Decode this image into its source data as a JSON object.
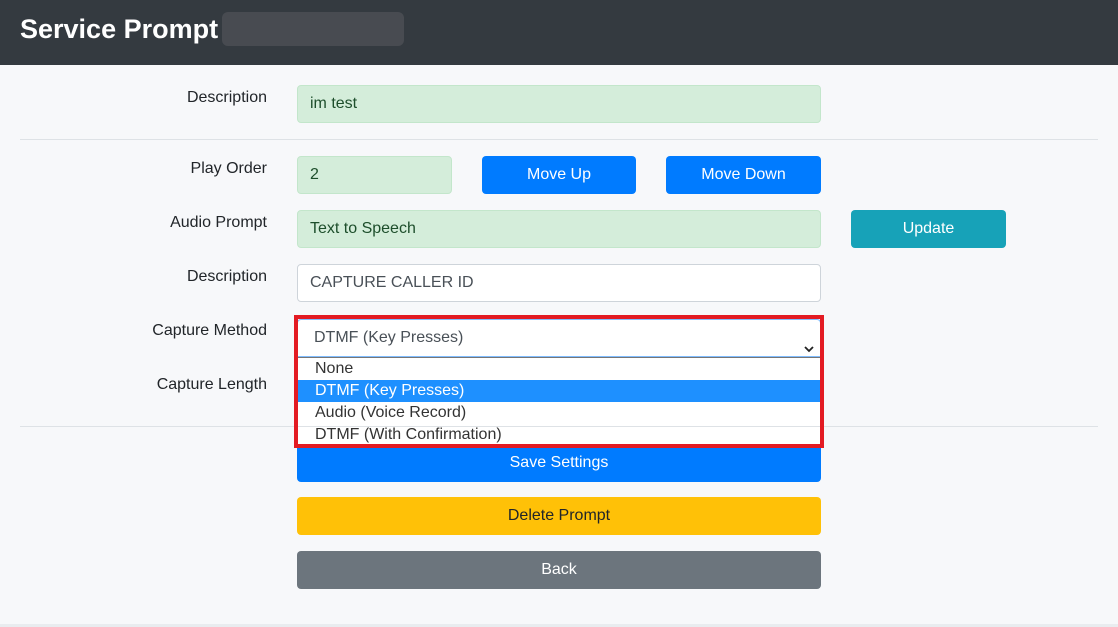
{
  "header": {
    "title": "Service Prompt"
  },
  "form": {
    "description": {
      "label": "Description",
      "value": "im test"
    },
    "play_order": {
      "label": "Play Order",
      "value": "2"
    },
    "move_up_label": "Move Up",
    "move_down_label": "Move Down",
    "audio_prompt": {
      "label": "Audio Prompt",
      "value": "Text to Speech"
    },
    "update_label": "Update",
    "prompt_description": {
      "label": "Description",
      "value": "CAPTURE CALLER ID"
    },
    "capture_method": {
      "label": "Capture Method",
      "value": "DTMF (Key Presses)",
      "options": [
        "None",
        "DTMF (Key Presses)",
        "Audio (Voice Record)",
        "DTMF (With Confirmation)"
      ],
      "selected_index": 1
    },
    "capture_length": {
      "label": "Capture Length"
    },
    "save_label": "Save Settings",
    "delete_label": "Delete Prompt",
    "back_label": "Back"
  },
  "colors": {
    "header_bg": "#343a40",
    "primary": "#007bff",
    "info": "#17a2b8",
    "warning": "#ffc107",
    "secondary": "#6c757d",
    "readonly_bg": "#d4edda",
    "highlight": "#e31b23"
  },
  "icons": {
    "select_caret": "chevron-down-icon"
  }
}
